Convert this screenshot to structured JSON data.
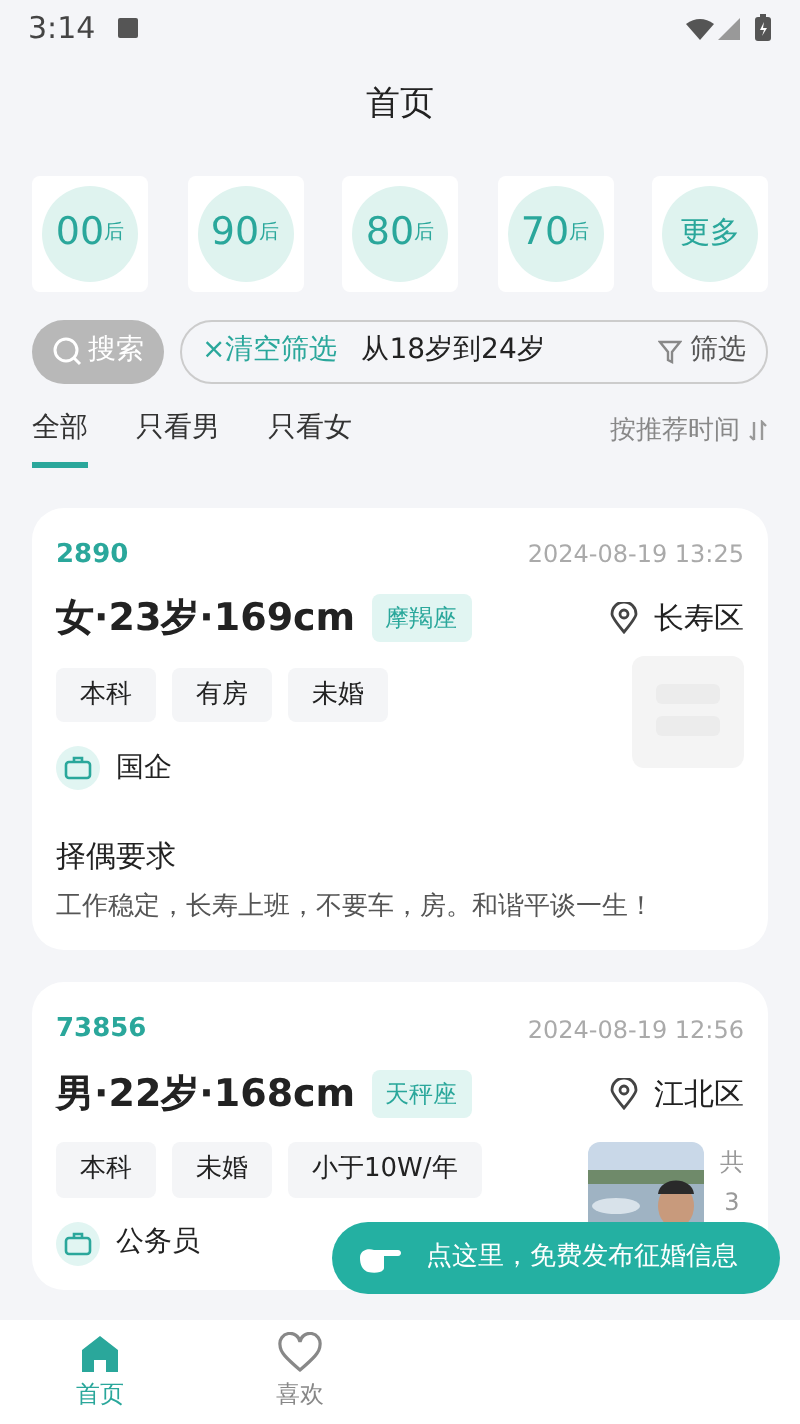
{
  "status_bar": {
    "time": "3:14"
  },
  "title": "首页",
  "age_filters": [
    {
      "kind": "decade",
      "number": "00",
      "suffix": "后"
    },
    {
      "kind": "decade",
      "number": "90",
      "suffix": "后"
    },
    {
      "kind": "decade",
      "number": "80",
      "suffix": "后"
    },
    {
      "kind": "decade",
      "number": "70",
      "suffix": "后"
    },
    {
      "kind": "more",
      "label": "更多"
    }
  ],
  "search_button": "搜索",
  "filter_bar": {
    "clear": "×清空筛选",
    "range": "从18岁到24岁",
    "filter": "筛选"
  },
  "tabs": [
    {
      "label": "全部",
      "selected": true
    },
    {
      "label": "只看男",
      "selected": false
    },
    {
      "label": "只看女",
      "selected": false
    }
  ],
  "sort": "按推荐时间",
  "cards": [
    {
      "id": "2890",
      "time": "2024-08-19 13:25",
      "headline": "女·23岁·169cm",
      "zodiac": "摩羯座",
      "location": "长寿区",
      "tags": [
        "本科",
        "有房",
        "未婚"
      ],
      "job": "国企",
      "photo": {
        "kind": "placeholder"
      },
      "requirement_title": "择偶要求",
      "requirement_text": "工作稳定，长寿上班，不要车，房。和谐平谈一生！"
    },
    {
      "id": "73856",
      "time": "2024-08-19 12:56",
      "headline": "男·22岁·168cm",
      "zodiac": "天秤座",
      "location": "江北区",
      "tags": [
        "本科",
        "未婚",
        "小于10W/年"
      ],
      "job": "公务员",
      "photo": {
        "kind": "picture",
        "count": [
          "共",
          "3"
        ]
      }
    }
  ],
  "fab": "点这里，免费发布征婚信息",
  "bottom_nav": [
    {
      "label": "首页",
      "selected": true
    },
    {
      "label": "喜欢",
      "selected": false
    }
  ]
}
